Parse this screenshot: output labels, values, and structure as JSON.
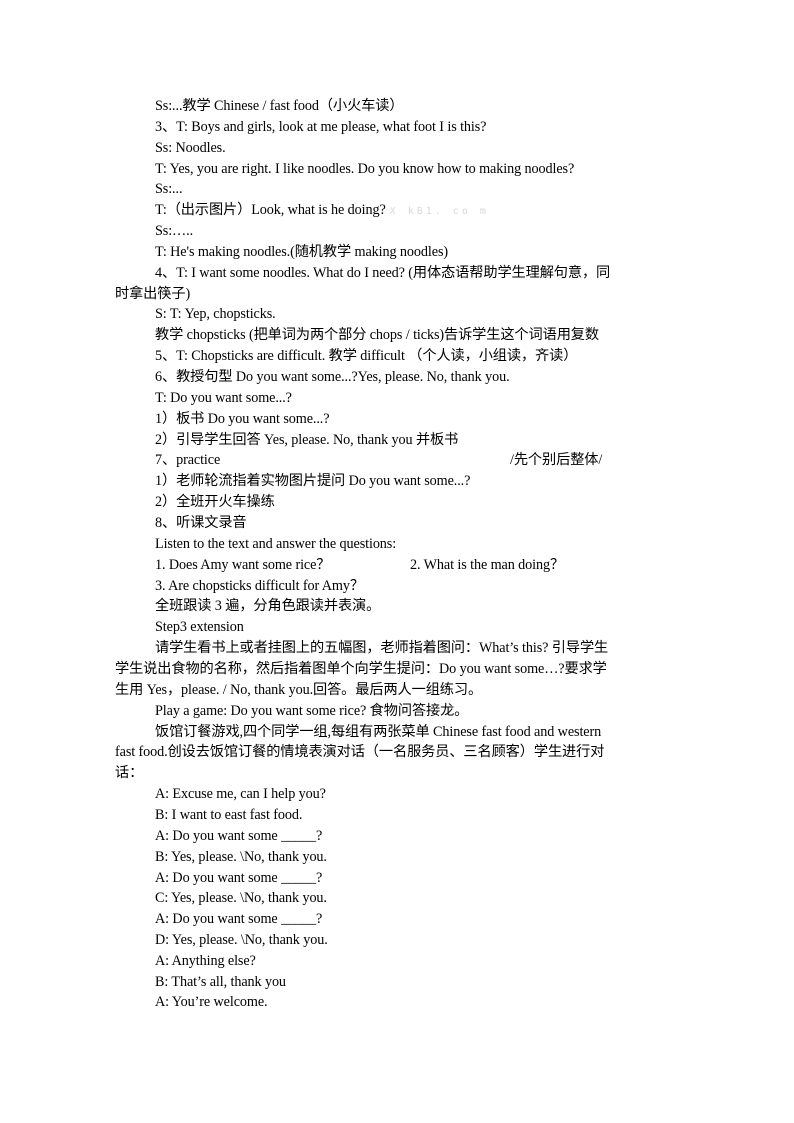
{
  "document": {
    "lines": [
      "Ss:...教学 Chinese / fast food（小火车读）",
      "3、T: Boys and girls, look at me please, what foot I is this?",
      "Ss: Noodles.",
      "T: Yes, you are right. I like noodles. Do you know how to making noodles?",
      "Ss:...",
      "T:（出示图片）Look, what is he doing?",
      "Ss:…..",
      "T: He's making noodles.(随机教学  making noodles)",
      "4、T: I want some noodles. What do I need? (用体态语帮助学生理解句意，同",
      "时拿出筷子)",
      "S:      T:  Yep, chopsticks.",
      "教学  chopsticks (把单词为两个部分 chops / ticks)告诉学生这个词语用复数",
      "5、T: Chopsticks are difficult.  教学  difficult  （个人读，小组读，齐读）",
      "6、教授句型 Do you want some...?Yes, please. No, thank you.",
      "T:    Do you want some...?",
      "1）板书 Do you want some...?",
      "2）引导学生回答 Yes, please. No, thank you 并板书",
      "7、practice",
      "1）老师轮流指着实物图片提问 Do you want some...?",
      "2）全班开火车操练",
      "8、听课文录音",
      "Listen to the text and answer the questions:",
      "1.  Does Amy want some rice？",
      "3.  Are chopsticks difficult for Amy？",
      "全班跟读 3 遍，分角色跟读并表演。",
      "Step3 extension",
      "请学生看书上或者挂图上的五幅图，老师指着图问：What’s this? 引导学生",
      "学生说出食物的名称，然后指着图单个向学生提问：Do you want some…?要求学",
      "生用 Yes，please. / No, thank you.回答。最后两人一组练习。",
      "Play a game: Do you want some rice?  食物问答接龙。",
      "饭馆订餐游戏,四个同学一组,每组有两张菜单 Chinese fast food and western",
      "fast food.创设去饭馆订餐的情境表演对话（一名服务员、三名顾客）学生进行对",
      "话："
    ],
    "watermark": "X kB1. co m",
    "practice_note": "/先个别后整体/",
    "question_2": "2.  What is the man doing？",
    "dialogue": [
      "A: Excuse me, can I help you?",
      "B: I want to east fast food.",
      "A: Do you want some _____?",
      "B: Yes, please. \\No, thank you.",
      "A: Do you want some _____?",
      "C: Yes, please. \\No, thank you.",
      "A: Do you want some _____?",
      "D: Yes, please. \\No, thank you.",
      "A: Anything else?",
      "B: That’s all, thank you",
      "A: You’re welcome."
    ]
  }
}
